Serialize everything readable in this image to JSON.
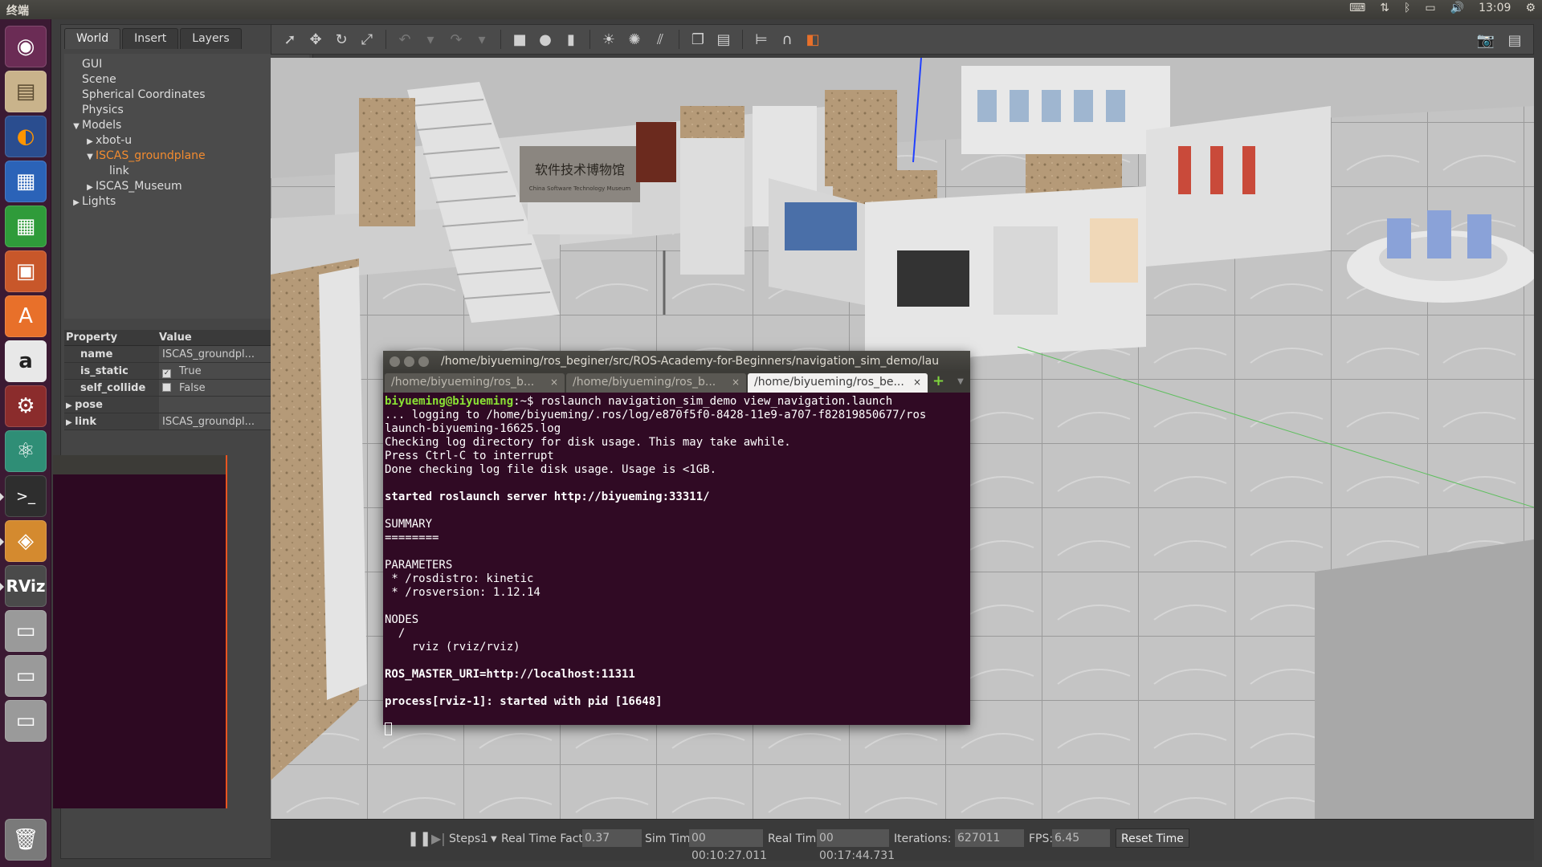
{
  "top_panel": {
    "title": "终端",
    "time": "13:09"
  },
  "launcher": {
    "items": [
      "ubuntu-dash",
      "files",
      "firefox",
      "libreoffice-writer",
      "libreoffice-calc",
      "libreoffice-impress",
      "software-center",
      "amazon",
      "system-settings",
      "atom",
      "terminal",
      "rqt",
      "rviz",
      "drive",
      "drive",
      "drive",
      "trash"
    ]
  },
  "gazebo": {
    "tabs": [
      "World",
      "Insert",
      "Layers"
    ],
    "tree": [
      {
        "label": "GUI",
        "indent": 0,
        "arrow": ""
      },
      {
        "label": "Scene",
        "indent": 0,
        "arrow": ""
      },
      {
        "label": "Spherical Coordinates",
        "indent": 0,
        "arrow": ""
      },
      {
        "label": "Physics",
        "indent": 0,
        "arrow": ""
      },
      {
        "label": "Models",
        "indent": 0,
        "arrow": "▼"
      },
      {
        "label": "xbot-u",
        "indent": 1,
        "arrow": "▶"
      },
      {
        "label": "ISCAS_groundplane",
        "indent": 1,
        "arrow": "▼",
        "selected": true
      },
      {
        "label": "link",
        "indent": 2,
        "arrow": ""
      },
      {
        "label": "ISCAS_Museum",
        "indent": 1,
        "arrow": "▶"
      },
      {
        "label": "Lights",
        "indent": 0,
        "arrow": "▶"
      }
    ],
    "properties": {
      "col_property": "Property",
      "col_value": "Value",
      "rows": [
        {
          "key": "name",
          "value": "ISCAS_groundpl..."
        },
        {
          "key": "is_static",
          "value": "True",
          "checkbox": true,
          "checked": true
        },
        {
          "key": "self_collide",
          "value": "False",
          "checkbox": true,
          "checked": false
        },
        {
          "key": "pose",
          "value": "",
          "group": true
        },
        {
          "key": "link",
          "value": "ISCAS_groundpl...",
          "group": true
        }
      ]
    },
    "bottom": {
      "steps_label": "Steps:",
      "steps_value": "1",
      "rtf_label": "Real Time Factor:",
      "rtf_value": "0.37",
      "sim_label": "Sim Time:",
      "sim_value": "00 00:10:27.011",
      "real_label": "Real Time:",
      "real_value": "00 00:17:44.731",
      "iter_label": "Iterations:",
      "iter_value": "627011",
      "fps_label": "FPS:",
      "fps_value": "6.45",
      "reset_label": "Reset Time"
    },
    "museum_sign": "软件技术博物馆",
    "museum_sign_sub": "China Software Technology Museum"
  },
  "terminal": {
    "title": "/home/biyueming/ros_beginer/src/ROS-Academy-for-Beginners/navigation_sim_demo/lau",
    "tabs": [
      {
        "label": "/home/biyueming/ros_b...",
        "active": false
      },
      {
        "label": "/home/biyueming/ros_b...",
        "active": false
      },
      {
        "label": "/home/biyueming/ros_be...",
        "active": true
      }
    ],
    "prompt": "biyueming@biyueming",
    "prompt_suffix": ":~$ ",
    "command": "roslaunch navigation_sim_demo view_navigation.launch",
    "lines": [
      "... logging to /home/biyueming/.ros/log/e870f5f0-8428-11e9-a707-f82819850677/ros",
      "launch-biyueming-16625.log",
      "Checking log directory for disk usage. This may take awhile.",
      "Press Ctrl-C to interrupt",
      "Done checking log file disk usage. Usage is <1GB.",
      "",
      "started roslaunch server http://biyueming:33311/",
      "",
      "SUMMARY",
      "========",
      "",
      "PARAMETERS",
      " * /rosdistro: kinetic",
      " * /rosversion: 1.12.14",
      "",
      "NODES",
      "  /",
      "    rviz (rviz/rviz)",
      "",
      "ROS_MASTER_URI=http://localhost:11311",
      "",
      "process[rviz-1]: started with pid [16648]"
    ],
    "bold_lines": [
      6,
      19,
      21
    ]
  }
}
